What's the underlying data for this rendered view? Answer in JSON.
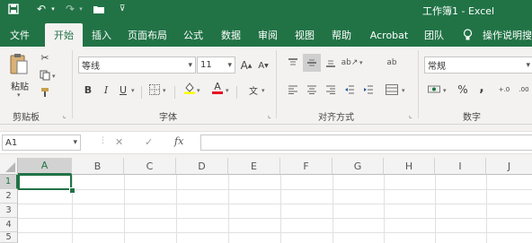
{
  "window": {
    "title": "工作簿1 - Excel"
  },
  "qat": {
    "icons": [
      "save-icon",
      "undo-icon",
      "redo-icon",
      "open-folder-icon",
      "customize-icon"
    ]
  },
  "tabs": [
    "文件",
    "开始",
    "插入",
    "页面布局",
    "公式",
    "数据",
    "审阅",
    "视图",
    "帮助",
    "Acrobat",
    "团队",
    "操作说明搜"
  ],
  "active_tab": "开始",
  "clipboard": {
    "paste_label": "粘贴",
    "group_label": "剪贴板"
  },
  "font": {
    "name": "等线",
    "size": "11",
    "grow": "A",
    "shrink": "A",
    "bold": "B",
    "italic": "I",
    "underline": "U",
    "font_color_glyph": "A",
    "highlight_glyph": "A",
    "phonetic_glyph": "文",
    "group_label": "字体"
  },
  "alignment": {
    "group_label": "对齐方式",
    "wrap_glyph": "ab"
  },
  "number": {
    "format": "常规",
    "percent": "%",
    "comma": ",",
    "group_label": "数字",
    "inc_decimal": "+.0",
    "dec_decimal": ".00"
  },
  "formula_bar": {
    "name_box": "A1",
    "cancel": "✕",
    "enter": "✓",
    "fx": "fx",
    "value": ""
  },
  "sheet": {
    "columns": [
      "A",
      "B",
      "C",
      "D",
      "E",
      "F",
      "G",
      "H",
      "I",
      "J"
    ],
    "rows": [
      "1",
      "2",
      "3",
      "4",
      "5"
    ],
    "selected_cell": "A1"
  },
  "colors": {
    "brand": "#217346",
    "ribbon_bg": "#f3f2f1",
    "font_color_underline": "#e81123",
    "highlight_underline": "#ffff00"
  }
}
